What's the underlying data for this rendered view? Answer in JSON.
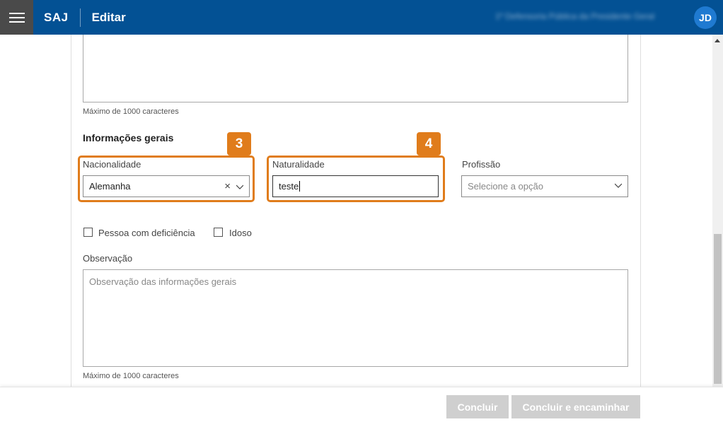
{
  "header": {
    "brand": "SAJ",
    "title": "Editar",
    "org_name": "1º Defensoria Pública da Presidente Geral",
    "avatar_initials": "JD",
    "color": "#035194"
  },
  "top_section": {
    "char_limit_hint": "Máximo de 1000 caracteres"
  },
  "general_info": {
    "title": "Informações gerais",
    "nationality": {
      "label": "Nacionalidade",
      "value": "Alemanha",
      "badge": "3"
    },
    "birthplace": {
      "label": "Naturalidade",
      "value": "teste",
      "badge": "4"
    },
    "profession": {
      "label": "Profissão",
      "placeholder": "Selecione a opção"
    },
    "checkboxes": [
      {
        "label": "Pessoa com deficiência",
        "checked": false
      },
      {
        "label": "Idoso",
        "checked": false
      }
    ],
    "observation": {
      "label": "Observação",
      "placeholder": "Observação das informações gerais",
      "char_limit_hint": "Máximo de 1000 caracteres"
    }
  },
  "footer": {
    "conclude_label": "Concluir",
    "conclude_forward_label": "Concluir e encaminhar"
  },
  "highlight_color": "#e07c1b"
}
